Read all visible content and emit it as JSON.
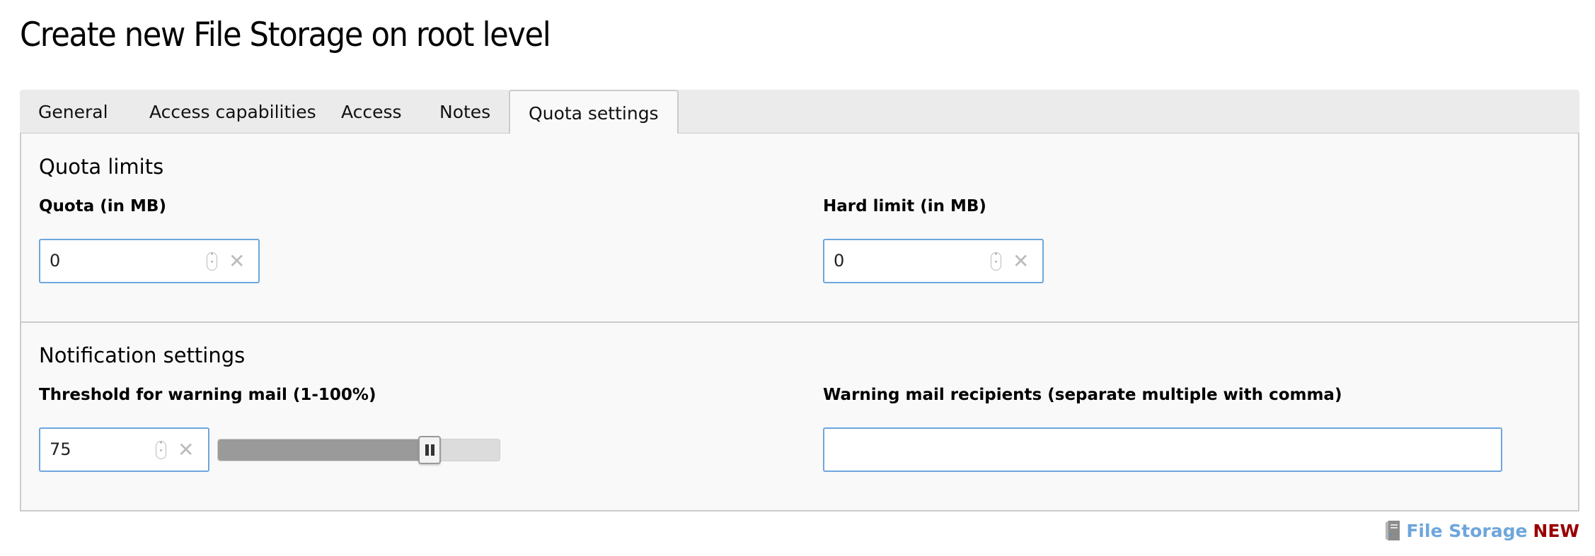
{
  "page": {
    "title": "Create new File Storage on root level"
  },
  "tabs": [
    {
      "label": "General",
      "active": false
    },
    {
      "label": "Access capabilities",
      "active": false
    },
    {
      "label": "Access",
      "active": false
    },
    {
      "label": "Notes",
      "active": false
    },
    {
      "label": "Quota settings",
      "active": true
    }
  ],
  "quota_limits": {
    "title": "Quota limits",
    "quota": {
      "label": "Quota (in MB)",
      "value": "0"
    },
    "hard_limit": {
      "label": "Hard limit (in MB)",
      "value": "0"
    }
  },
  "notification_settings": {
    "title": "Notification settings",
    "threshold": {
      "label": "Threshold for warning mail (1-100%)",
      "value": "75",
      "slider_percent": 75
    },
    "recipients": {
      "label": "Warning mail recipients (separate multiple with comma)",
      "value": "",
      "placeholder": ""
    }
  },
  "icons": {
    "spinner": "spinner-updown-icon",
    "clear": "clear-x-icon",
    "record": "server-icon"
  },
  "footer": {
    "record_type": "File Storage",
    "record_status": "NEW"
  },
  "colors": {
    "accent": "#6ea6db",
    "status_new": "#990000",
    "slider_fill": "#9a9a9a"
  }
}
